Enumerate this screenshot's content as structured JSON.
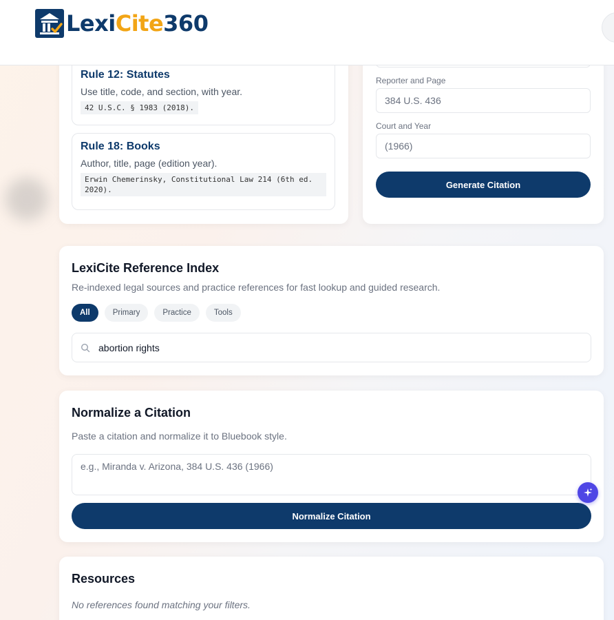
{
  "brand": {
    "part1": "Lexi",
    "part2": "Cite",
    "part3": "360"
  },
  "rules": [
    {
      "title": "Rule 12: Statutes",
      "desc": "Use title, code, and section, with year.",
      "example": "42 U.S.C. § 1983 (2018)."
    },
    {
      "title": "Rule 18: Books",
      "desc": "Author, title, page (edition year).",
      "example": "Erwin Chemerinsky, Constitutional Law 214 (6th ed. 2020)."
    }
  ],
  "citation_form": {
    "reporter_label": "Reporter and Page",
    "reporter_value": "384 U.S. 436",
    "court_label": "Court and Year",
    "court_value": "(1966)",
    "generate_label": "Generate Citation"
  },
  "reference_index": {
    "title": "LexiCite Reference Index",
    "subtitle": "Re-indexed legal sources and practice references for fast lookup and guided research.",
    "filters": [
      "All",
      "Primary",
      "Practice",
      "Tools"
    ],
    "active_filter": "All",
    "search_value": "abortion rights"
  },
  "normalize": {
    "title": "Normalize a Citation",
    "subtitle": "Paste a citation and normalize it to Bluebook style.",
    "placeholder": "e.g., Miranda v. Arizona, 384 U.S. 436 (1966)",
    "button_label": "Normalize Citation"
  },
  "resources": {
    "title": "Resources",
    "empty_message": "No references found matching your filters."
  },
  "colors": {
    "brand_navy": "#0e3a6b",
    "brand_orange": "#f2a516",
    "accent_purple": "#4f46e5"
  },
  "icons": {
    "logo": "courthouse-check-icon",
    "search": "search-icon",
    "ai": "sparkle-icon"
  }
}
